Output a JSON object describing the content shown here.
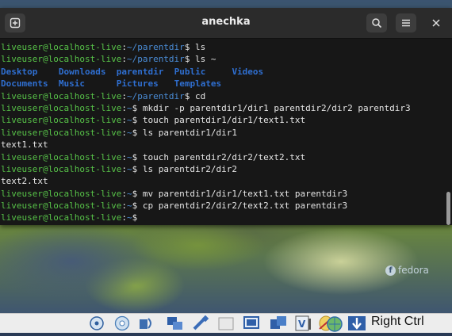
{
  "window": {
    "title": "anechka"
  },
  "terminal": {
    "lines": [
      [
        {
          "t": "liveuser@localhost-live",
          "c": "user"
        },
        {
          "t": ":",
          "c": "plain"
        },
        {
          "t": "~/parentdir",
          "c": "path"
        },
        {
          "t": "$ ls",
          "c": "plain"
        }
      ],
      [
        {
          "t": "liveuser@localhost-live",
          "c": "user"
        },
        {
          "t": ":",
          "c": "plain"
        },
        {
          "t": "~/parentdir",
          "c": "path"
        },
        {
          "t": "$ ls ~",
          "c": "plain"
        }
      ],
      [
        {
          "t": "Desktop    ",
          "c": "dir"
        },
        {
          "t": "Downloads  ",
          "c": "dir"
        },
        {
          "t": "parentdir  ",
          "c": "dir"
        },
        {
          "t": "Public     ",
          "c": "dir"
        },
        {
          "t": "Videos",
          "c": "dir"
        }
      ],
      [
        {
          "t": "Documents  ",
          "c": "dir"
        },
        {
          "t": "Music      ",
          "c": "dir"
        },
        {
          "t": "Pictures   ",
          "c": "dir"
        },
        {
          "t": "Templates",
          "c": "dir"
        }
      ],
      [
        {
          "t": "liveuser@localhost-live",
          "c": "user"
        },
        {
          "t": ":",
          "c": "plain"
        },
        {
          "t": "~/parentdir",
          "c": "path"
        },
        {
          "t": "$ cd",
          "c": "plain"
        }
      ],
      [
        {
          "t": "liveuser@localhost-live",
          "c": "user"
        },
        {
          "t": ":",
          "c": "plain"
        },
        {
          "t": "~",
          "c": "path"
        },
        {
          "t": "$ mkdir -p parentdir1/dir1 parentdir2/dir2 parentdir3",
          "c": "plain"
        }
      ],
      [
        {
          "t": "liveuser@localhost-live",
          "c": "user"
        },
        {
          "t": ":",
          "c": "plain"
        },
        {
          "t": "~",
          "c": "path"
        },
        {
          "t": "$ touch parentdir1/dir1/text1.txt",
          "c": "plain"
        }
      ],
      [
        {
          "t": "liveuser@localhost-live",
          "c": "user"
        },
        {
          "t": ":",
          "c": "plain"
        },
        {
          "t": "~",
          "c": "path"
        },
        {
          "t": "$ ls parentdir1/dir1",
          "c": "plain"
        }
      ],
      [
        {
          "t": "text1.txt",
          "c": "plain"
        }
      ],
      [
        {
          "t": "liveuser@localhost-live",
          "c": "user"
        },
        {
          "t": ":",
          "c": "plain"
        },
        {
          "t": "~",
          "c": "path"
        },
        {
          "t": "$ touch parentdir2/dir2/text2.txt",
          "c": "plain"
        }
      ],
      [
        {
          "t": "liveuser@localhost-live",
          "c": "user"
        },
        {
          "t": ":",
          "c": "plain"
        },
        {
          "t": "~",
          "c": "path"
        },
        {
          "t": "$ ls parentdir2/dir2",
          "c": "plain"
        }
      ],
      [
        {
          "t": "text2.txt",
          "c": "plain"
        }
      ],
      [
        {
          "t": "liveuser@localhost-live",
          "c": "user"
        },
        {
          "t": ":",
          "c": "plain"
        },
        {
          "t": "~",
          "c": "path"
        },
        {
          "t": "$ mv parentdir1/dir1/text1.txt parentdir3",
          "c": "plain"
        }
      ],
      [
        {
          "t": "liveuser@localhost-live",
          "c": "user"
        },
        {
          "t": ":",
          "c": "plain"
        },
        {
          "t": "~",
          "c": "path"
        },
        {
          "t": "$ cp parentdir2/dir2/text2.txt parentdir3",
          "c": "plain"
        }
      ],
      [
        {
          "t": "liveuser@localhost-live",
          "c": "user"
        },
        {
          "t": ":",
          "c": "plain"
        },
        {
          "t": "~",
          "c": "path"
        },
        {
          "t": "$ ",
          "c": "plain"
        }
      ]
    ]
  },
  "desktop": {
    "watermark": "fedora"
  },
  "statusbar": {
    "host_key": "Right Ctrl",
    "icons": [
      "hard-disk-icon",
      "optical-disk-icon",
      "audio-icon",
      "network-icon",
      "usb-icon",
      "shared-folders-icon",
      "display-icon",
      "video-capture-icon",
      "virtualization-icon",
      "mouse-integration-icon",
      "globe-icon",
      "host-key-arrow-icon"
    ]
  },
  "colors": {
    "user": "#57c248",
    "path": "#4a8cd6",
    "dir": "#2f6fd1",
    "terminal_bg": "#171717"
  }
}
